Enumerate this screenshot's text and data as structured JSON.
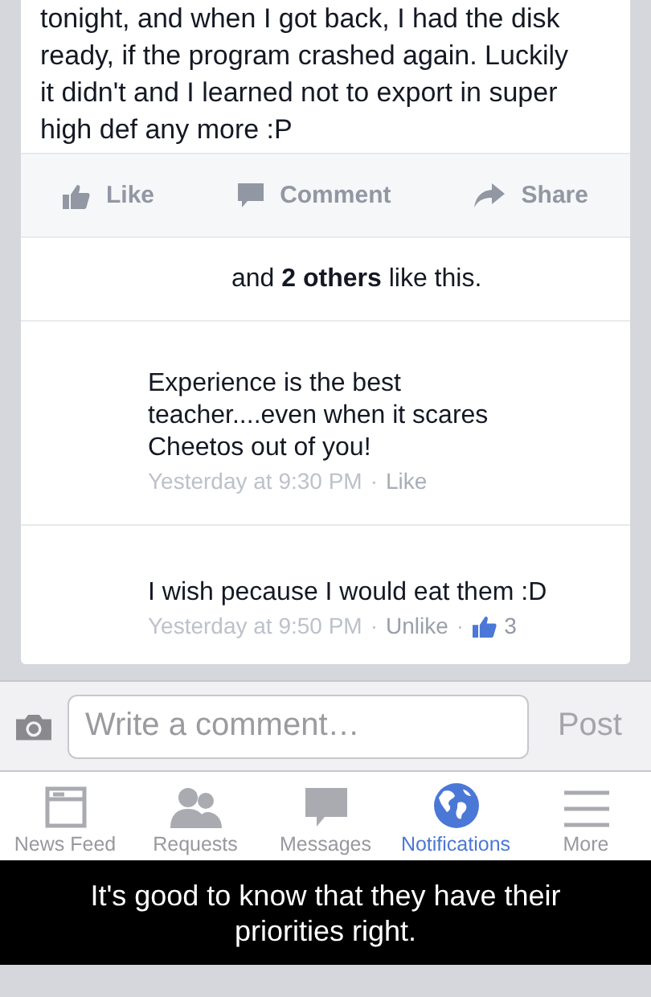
{
  "post": {
    "text_lines": [
      "tonight, and when I got back, I had the disk",
      "ready, if the program crashed again. Luckily",
      "it didn't and I learned not to export in super",
      "high def any more :P"
    ]
  },
  "actions": [
    {
      "kind": "like",
      "label": "Like"
    },
    {
      "kind": "comment",
      "label": "Comment"
    },
    {
      "kind": "share",
      "label": "Share"
    }
  ],
  "likes_summary": "and **2 others** like this.",
  "comments": [
    {
      "text": "Experience is the best teacher....even when it scares Cheetos out of you!",
      "time": "Yesterday at 9:30 PM",
      "action": "Like",
      "separators": [
        "·"
      ],
      "liked": false
    },
    {
      "text": "I wish pecause I would eat them :D",
      "time": "Yesterday at 9:50 PM",
      "action": "Unlike",
      "separators": [
        "·",
        "·"
      ],
      "like_count": "3",
      "liked": true
    }
  ],
  "composer": {
    "placeholder": "Write a comment…",
    "post_button": "Post"
  },
  "tab_bar": [
    {
      "kind": "feed",
      "label": "News Feed",
      "selected": false
    },
    {
      "kind": "requests",
      "label": "Requests",
      "selected": false
    },
    {
      "kind": "messages",
      "label": "Messages",
      "selected": false
    },
    {
      "kind": "globe",
      "label": "Notifications",
      "selected": true
    },
    {
      "kind": "menu",
      "label": "More",
      "selected": false
    }
  ],
  "caption": "It's good to know that they have their priorities right."
}
